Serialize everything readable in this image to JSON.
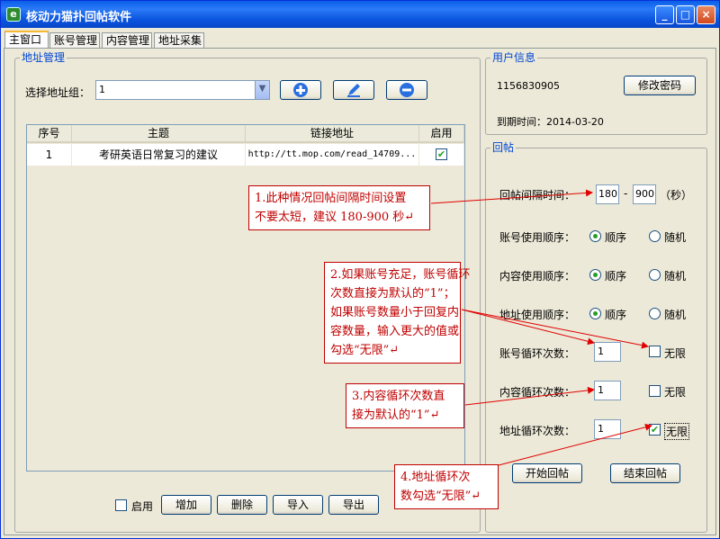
{
  "window": {
    "title": "核动力猫扑回帖软件",
    "minimize": "_",
    "maximize": "□",
    "close": "×"
  },
  "tabs": [
    "主窗口",
    "账号管理",
    "内容管理",
    "地址采集"
  ],
  "address": {
    "group_label": "地址管理",
    "select_label": "选择地址组：",
    "select_value": "1",
    "table": {
      "headers": [
        "序号",
        "主题",
        "链接地址",
        "启用"
      ],
      "rows": [
        {
          "index": "1",
          "subject": "考研英语日常复习的建议",
          "url": "http://tt.mop.com/read_14709...",
          "enabled": "✔"
        }
      ]
    },
    "enable_label": "启用",
    "buttons": {
      "add": "增加",
      "delete": "删除",
      "import": "导入",
      "export": "导出"
    }
  },
  "user": {
    "group_label": "用户信息",
    "account": "1156830905",
    "change_pw": "修改密码",
    "expire": "到期时间：2014-03-20"
  },
  "reply": {
    "group_label": "回帖",
    "interval_label": "回帖间隔时间：",
    "interval_min": "180",
    "interval_dash": "-",
    "interval_max": "900",
    "interval_unit": "（秒）",
    "account_order": "账号使用顺序：",
    "content_order": "内容使用顺序：",
    "address_order": "地址使用顺序：",
    "seq": "顺序",
    "random": "随机",
    "account_loops": "账号循环次数：",
    "content_loops": "内容循环次数：",
    "address_loops": "地址循环次数：",
    "loop_value": "1",
    "unlimited": "无限",
    "check": "✔",
    "start": "开始回帖",
    "stop": "结束回帖"
  },
  "annotations": {
    "a1": [
      "1.此种情况回帖间隔时间设置",
      "不要太短，建议 180-900 秒↵"
    ],
    "a2": [
      "2.如果账号充足，账号循环",
      "次数直接为默认的“1”；",
      "如果账号数量小于回复内",
      "容数量，输入更大的值或",
      "勾选“无限”↵"
    ],
    "a3": [
      "3.内容循环次数直",
      "接为默认的“1”↵"
    ],
    "a4": [
      "4.地址循环次",
      "数勾选“无限”↵"
    ]
  }
}
